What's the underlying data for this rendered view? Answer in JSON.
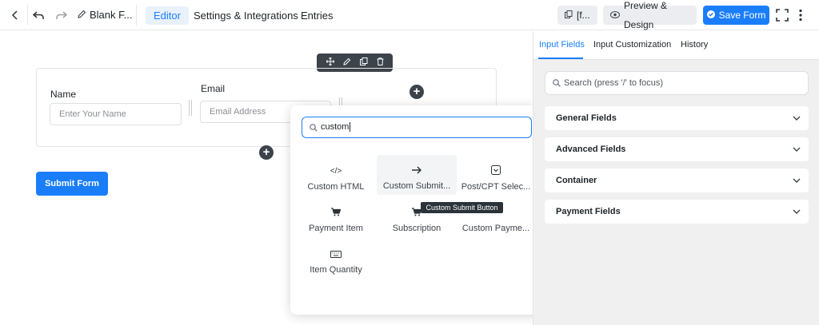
{
  "topbar": {
    "title": "Blank F...",
    "tabs": [
      {
        "label": "Editor",
        "active": true
      },
      {
        "label": "Settings & Integrations",
        "active": false
      },
      {
        "label": "Entries",
        "active": false
      }
    ],
    "shortcode_label": "[f...",
    "preview_label": "Preview & Design",
    "save_label": "Save Form"
  },
  "form": {
    "fields": [
      {
        "label": "Name",
        "placeholder": "Enter Your Name"
      },
      {
        "label": "Email",
        "placeholder": "Email Address"
      }
    ],
    "submit_label": "Submit Form"
  },
  "popup": {
    "search_value": "custom",
    "items": [
      {
        "label": "Custom HTML",
        "icon": "code-icon"
      },
      {
        "label": "Custom Submit...",
        "icon": "arrow-right-icon"
      },
      {
        "label": "Post/CPT Selec...",
        "icon": "post-select-icon"
      },
      {
        "label": "Payment Item",
        "icon": "cart-icon"
      },
      {
        "label": "Subscription",
        "icon": "cart-icon"
      },
      {
        "label": "Custom Payme...",
        "icon": "payment-icon"
      },
      {
        "label": "Item Quantity",
        "icon": "keyboard-icon"
      }
    ],
    "tooltip": "Custom Submit Button"
  },
  "sidebar": {
    "tabs": [
      {
        "label": "Input Fields",
        "active": true
      },
      {
        "label": "Input Customization",
        "active": false
      },
      {
        "label": "History",
        "active": false
      }
    ],
    "search_placeholder": "Search (press '/' to focus)",
    "sections": [
      "General Fields",
      "Advanced Fields",
      "Container",
      "Payment Fields"
    ]
  },
  "colors": {
    "accent": "#1a7efb",
    "dark": "#3c434a"
  }
}
